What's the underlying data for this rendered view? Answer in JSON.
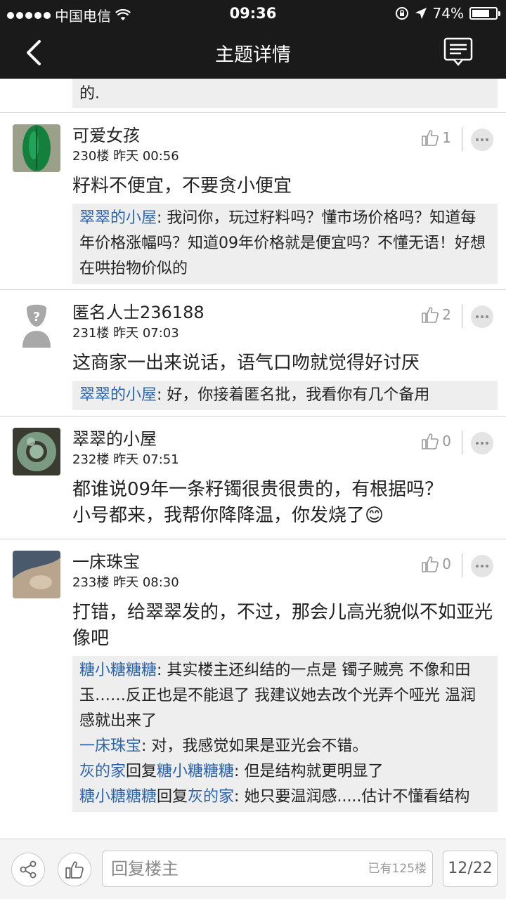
{
  "status_bar": {
    "carrier": "中国电信",
    "time": "09:36",
    "battery": "74%",
    "battery_level": 0.74
  },
  "nav": {
    "title": "主题详情"
  },
  "top_quote": {
    "text": "的."
  },
  "posts": [
    {
      "username": "可爱女孩",
      "floor": "230楼",
      "time": "昨天 00:56",
      "likes": "1",
      "body": "籽料不便宜，不要贪小便宜",
      "replies": [
        {
          "author": "翠翠的小屋",
          "text": ": 我问你，玩过籽料吗？懂市场价格吗？知道每年价格涨幅吗？知道09年价格就是便宜吗？不懂无语！好想在哄抬物价似的"
        }
      ]
    },
    {
      "username": "匿名人士236188",
      "floor": "231楼",
      "time": "昨天 07:03",
      "likes": "2",
      "body": "这商家一出来说话，语气口吻就觉得好讨厌",
      "replies": [
        {
          "author": "翠翠的小屋",
          "text": ": 好，你接着匿名批，我看你有几个备用"
        }
      ]
    },
    {
      "username": "翠翠的小屋",
      "floor": "232楼",
      "time": "昨天 07:51",
      "likes": "0",
      "body_line1": "都谁说09年一条籽镯很贵很贵的，有根据吗？",
      "body_line2": "小号都来，我帮你降降温，你发烧了",
      "emoji": "😊"
    },
    {
      "username": "一床珠宝",
      "floor": "233楼",
      "time": "昨天 08:30",
      "likes": "0",
      "body": "打错，给翠翠发的，不过，那会儿高光貌似不如亚光像吧",
      "replies": [
        {
          "author": "糖小糖糖糖",
          "text": ": 其实楼主还纠结的一点是 镯子贼亮 不像和田玉……反正也是不能退了 我建议她去改个光弄个哑光 温润感就出来了"
        },
        {
          "author": "一床珠宝",
          "text": ": 对，我感觉如果是亚光会不错。"
        },
        {
          "author": "灰的家",
          "mid": "回复",
          "target": "糖小糖糖糖",
          "text": ": 但是结构就更明显了"
        },
        {
          "author": "糖小糖糖糖",
          "mid": "回复",
          "target": "灰的家",
          "text": ": 她只要温润感.....估计不懂看结构"
        }
      ]
    }
  ],
  "bottom": {
    "placeholder": "回复楼主",
    "count_text": "已有125楼",
    "page": "12/22"
  },
  "icons": {
    "back": "chevron-left-icon",
    "menu": "message-menu-icon",
    "like": "thumbs-up-icon",
    "share": "share-icon",
    "more": "more-dots-icon"
  }
}
